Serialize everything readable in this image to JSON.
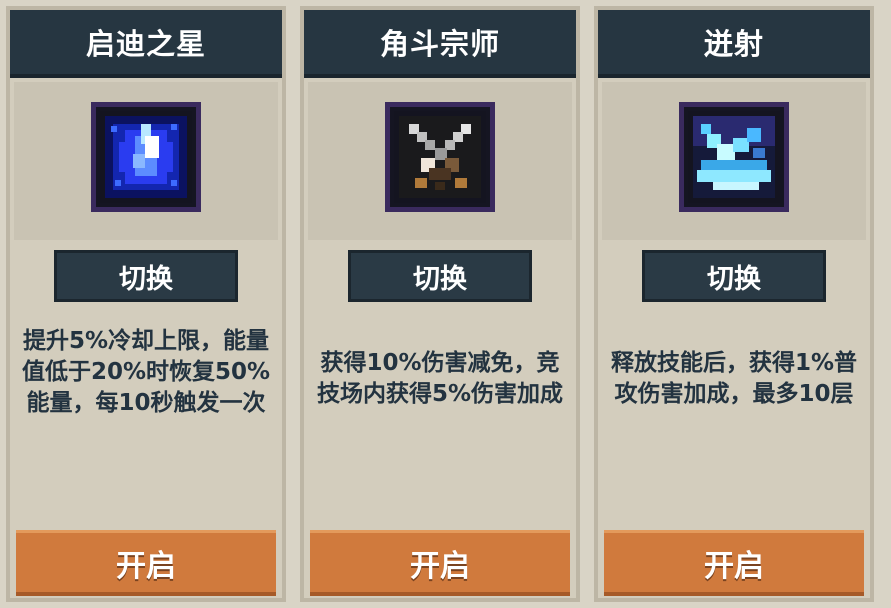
{
  "cards": [
    {
      "title": "启迪之星",
      "icon": "blue-star-crystal-icon",
      "switch_label": "切换",
      "description": "提升5%冷却上限，能量值低于20%时恢复50%能量，每10秒触发一次",
      "action_label": "开启"
    },
    {
      "title": "角斗宗师",
      "icon": "crossed-swords-icon",
      "switch_label": "切换",
      "description": "获得10%伤害减免，竞技场内获得5%伤害加成",
      "action_label": "开启"
    },
    {
      "title": "迸射",
      "icon": "cyan-burst-icon",
      "switch_label": "切换",
      "description": "释放技能后，获得1%普攻伤害加成，最多10层",
      "action_label": "开启"
    }
  ],
  "colors": {
    "header": "#263641",
    "panel": "#d3cdbd",
    "switch_button": "#2a3a45",
    "open_button": "#d07a3d",
    "text": "#233340"
  }
}
